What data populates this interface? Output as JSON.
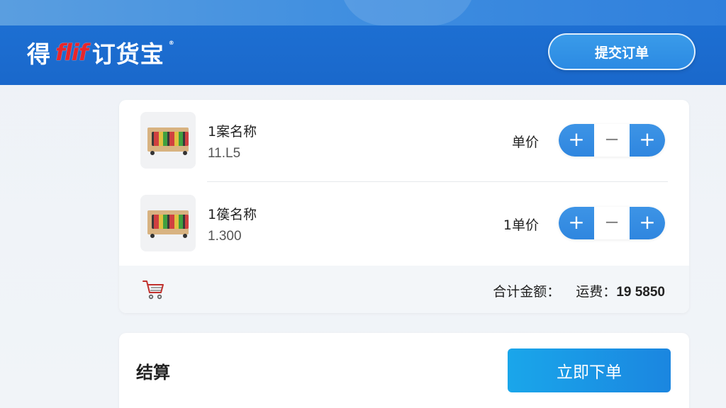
{
  "header": {
    "logo_prefix": "得",
    "logo_mark": "flif",
    "logo_suffix": "订货宝",
    "logo_reg": "®",
    "submit_label": "提交订单"
  },
  "items": [
    {
      "name": "1案名称",
      "price": "11.L5",
      "unit_label": "单价",
      "thumb_icon": "shelf-product-image"
    },
    {
      "name": "1篌名称",
      "price": "1.300",
      "unit_label": "1单价",
      "thumb_icon": "shelf-product-image"
    }
  ],
  "stepper": {
    "plus": "+",
    "minus": "−"
  },
  "footer": {
    "cart_icon": "cart-icon",
    "total_label": "合计金额：",
    "shipping_label": "运费：",
    "amount": "19 5850"
  },
  "checkout": {
    "label": "结算",
    "place_order_label": "立即下单"
  },
  "colors": {
    "header_blue": "#1d6fd2",
    "accent_blue": "#2f86df",
    "logo_red": "#e8262b"
  }
}
